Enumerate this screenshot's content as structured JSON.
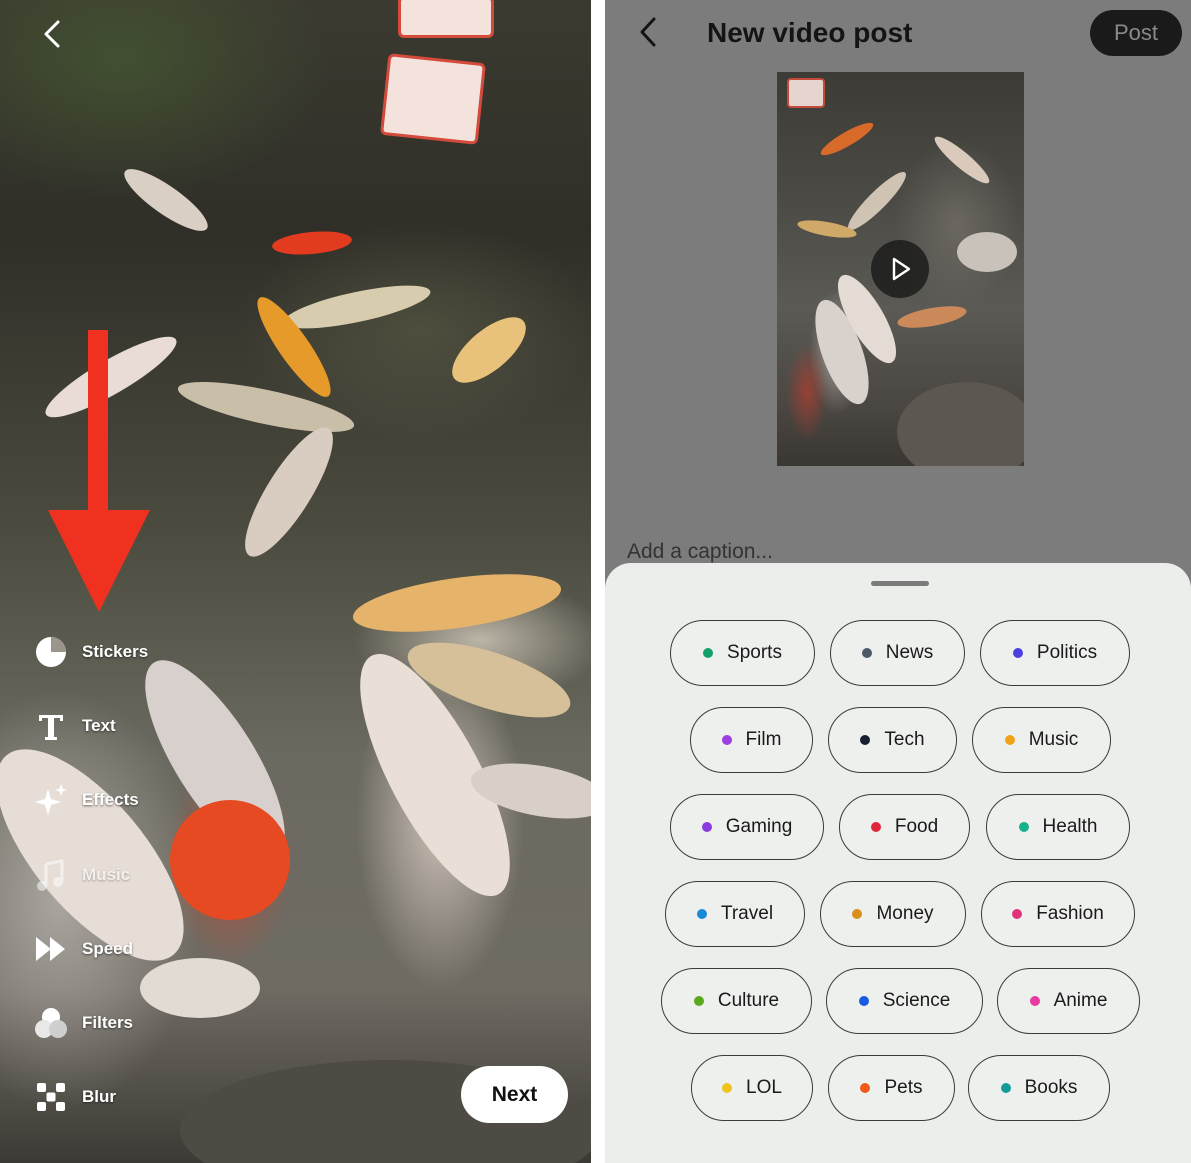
{
  "left_panel": {
    "tools": [
      {
        "label": "Stickers",
        "icon": "stickers-icon",
        "faded": false
      },
      {
        "label": "Text",
        "icon": "text-icon",
        "faded": false
      },
      {
        "label": "Effects",
        "icon": "sparkle-icon",
        "faded": false
      },
      {
        "label": "Music",
        "icon": "music-icon",
        "faded": true
      },
      {
        "label": "Speed",
        "icon": "speed-icon",
        "faded": false
      },
      {
        "label": "Filters",
        "icon": "filters-icon",
        "faded": false
      },
      {
        "label": "Blur",
        "icon": "blur-icon",
        "faded": false
      }
    ],
    "next_label": "Next",
    "arrow_color": "#f0311f"
  },
  "right_panel": {
    "title": "New video post",
    "post_label": "Post",
    "caption_placeholder": "Add a caption...",
    "topics": [
      {
        "label": "Sports",
        "color": "#13a06b"
      },
      {
        "label": "News",
        "color": "#4a5a68"
      },
      {
        "label": "Politics",
        "color": "#4b3fe0"
      },
      {
        "label": "Film",
        "color": "#9b3fe0"
      },
      {
        "label": "Tech",
        "color": "#172030"
      },
      {
        "label": "Music",
        "color": "#f0a21c"
      },
      {
        "label": "Gaming",
        "color": "#8a3ce0"
      },
      {
        "label": "Food",
        "color": "#e0263a"
      },
      {
        "label": "Health",
        "color": "#18b08a"
      },
      {
        "label": "Travel",
        "color": "#1a8ad8"
      },
      {
        "label": "Money",
        "color": "#d8901a"
      },
      {
        "label": "Fashion",
        "color": "#e0327a"
      },
      {
        "label": "Culture",
        "color": "#5aa81e"
      },
      {
        "label": "Science",
        "color": "#1a5ae0"
      },
      {
        "label": "Anime",
        "color": "#e83aa0"
      },
      {
        "label": "LOL",
        "color": "#f0c21c"
      },
      {
        "label": "Pets",
        "color": "#f0581c"
      },
      {
        "label": "Books",
        "color": "#129a98"
      }
    ]
  }
}
